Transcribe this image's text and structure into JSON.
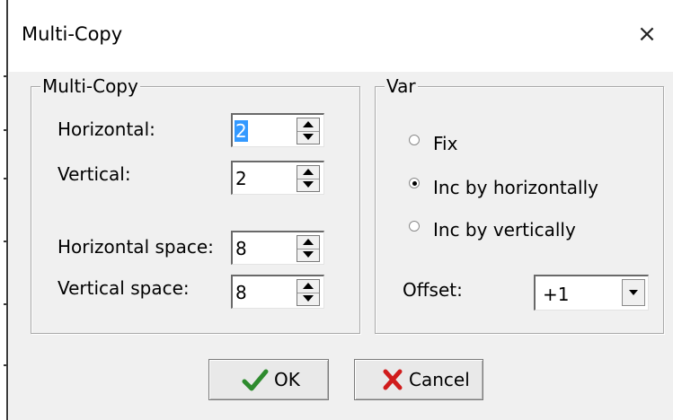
{
  "window": {
    "title": "Multi-Copy",
    "close_glyph": "×"
  },
  "multicopy_group": {
    "legend": "Multi-Copy",
    "horizontal_label": "Horizontal:",
    "horizontal_value": "2",
    "vertical_label": "Vertical:",
    "vertical_value": "2",
    "hspace_label": "Horizontal space:",
    "hspace_value": "8",
    "vspace_label": "Vertical space:",
    "vspace_value": "8"
  },
  "var_group": {
    "legend": "Var",
    "options": [
      {
        "label": "Fix",
        "selected": false
      },
      {
        "label": "Inc by horizontally",
        "selected": true
      },
      {
        "label": "Inc by vertically",
        "selected": false
      }
    ],
    "offset_label": "Offset:",
    "offset_value": "+1"
  },
  "buttons": {
    "ok_label": "OK",
    "cancel_label": "Cancel"
  },
  "icons": {
    "ok": "check-icon",
    "cancel": "x-icon",
    "spin": "spin-arrows-icon",
    "dropdown": "dropdown-arrow-icon"
  },
  "colors": {
    "dialog_bg": "#f0f0f0",
    "selection": "#3399ff",
    "ok_check": "#2e8b2e",
    "cancel_x": "#d01c1c"
  }
}
